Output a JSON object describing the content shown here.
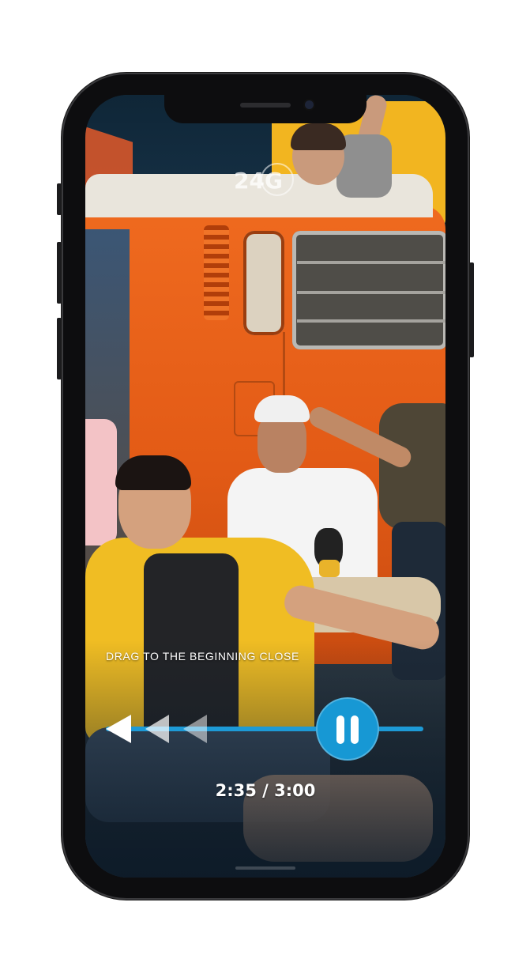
{
  "video_player": {
    "watermark": "24G",
    "hint_label": "DRAG TO THE BEGINNING CLOSE",
    "time_display": "2:35 / 3:00",
    "progress_fraction": 0.861,
    "state": "playing"
  },
  "icons": {
    "rewind": "rewind-arrows-icon",
    "pause": "pause-icon",
    "watermark": "24g-logo-icon"
  },
  "colors": {
    "accent": "#1798d4",
    "track": "#1d9ad6",
    "phone_frame": "#0d0d0f"
  }
}
